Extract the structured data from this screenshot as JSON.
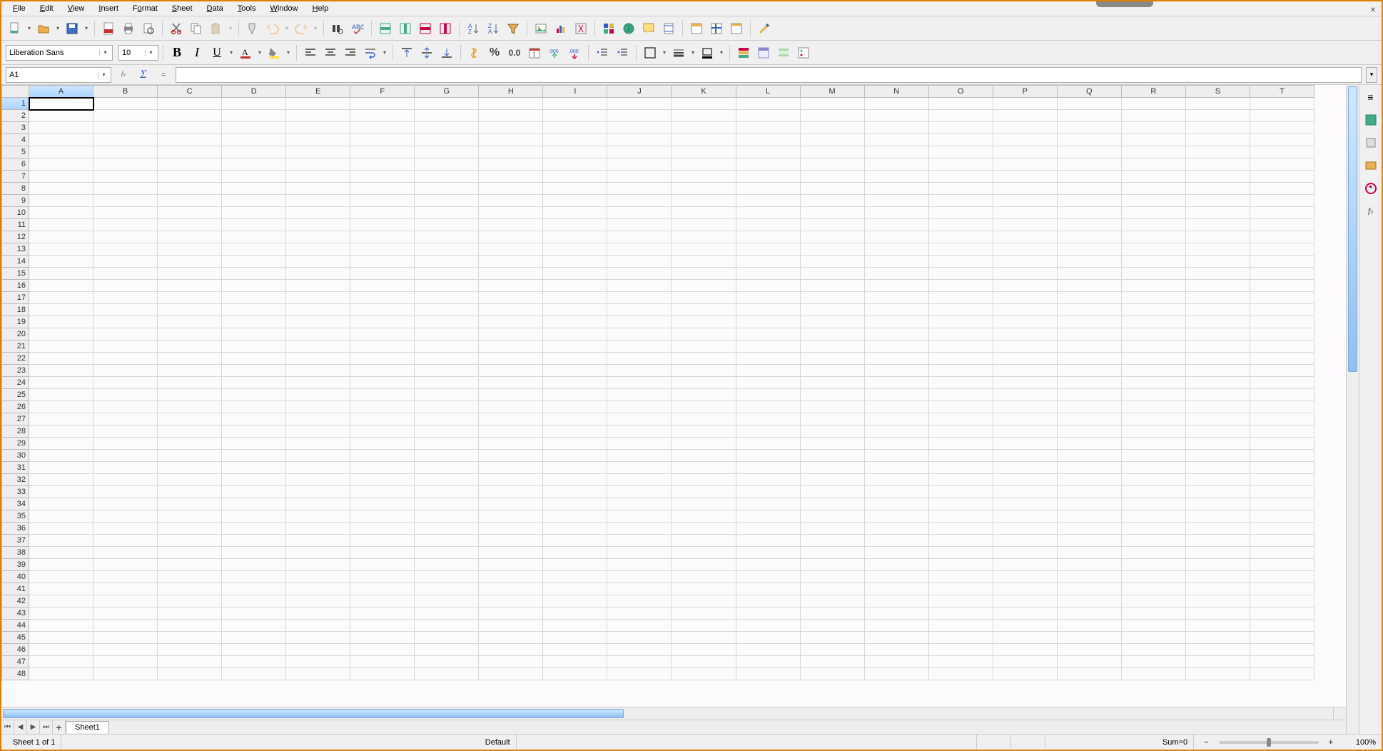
{
  "menus": [
    "File",
    "Edit",
    "View",
    "Insert",
    "Format",
    "Sheet",
    "Data",
    "Tools",
    "Window",
    "Help"
  ],
  "font": {
    "name": "Liberation Sans",
    "size": "10"
  },
  "name_box": "A1",
  "formula": "",
  "columns": [
    "A",
    "B",
    "C",
    "D",
    "E",
    "F",
    "G",
    "H",
    "I",
    "J",
    "K",
    "L",
    "M",
    "N",
    "O",
    "P",
    "Q",
    "R",
    "S",
    "T"
  ],
  "rows": 48,
  "active_cell": {
    "col": 0,
    "row": 0
  },
  "sheet_tab": "Sheet1",
  "status": {
    "sheet_info": "Sheet 1 of 1",
    "style": "Default",
    "sum": "Sum=0",
    "zoom": "100%"
  },
  "fmt": {
    "percent": "%",
    "number": "0.0",
    "add_dec": ".000",
    "del_dec": ".000"
  }
}
